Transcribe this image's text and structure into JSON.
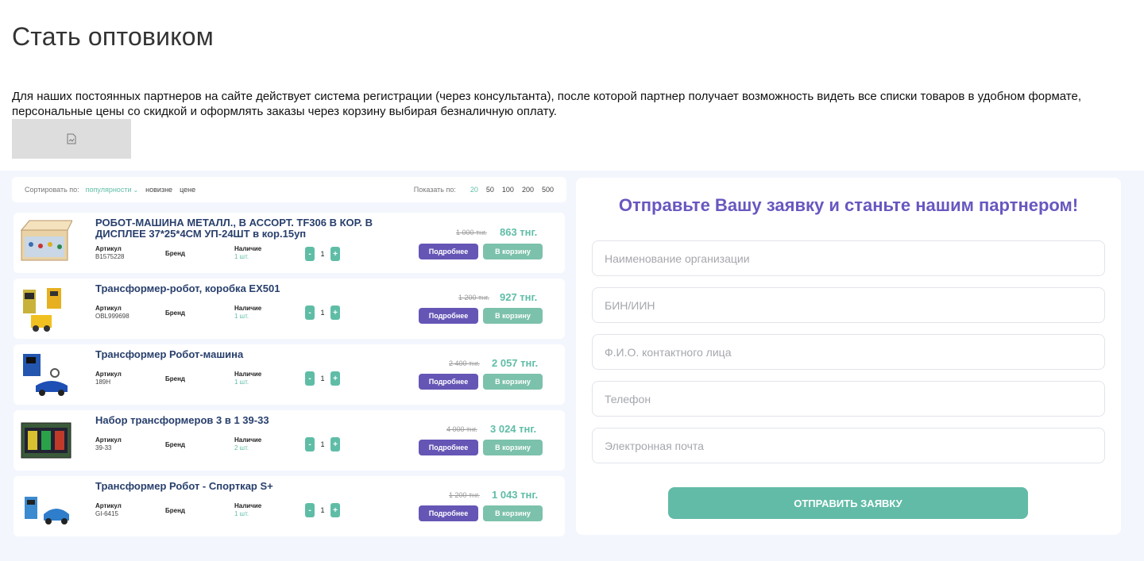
{
  "page": {
    "title": "Стать оптовиком",
    "intro": "Для наших постоянных партнеров на сайте действует система регистрации (через консультанта), после которой партнер получает возможность видеть все списки товаров в удобном формате, персональные цены со скидкой и оформлять заказы через корзину выбирая безналичную оплату."
  },
  "preview": {
    "sort_label": "Сортировать по:",
    "sort_options": [
      "популярности",
      "новизне",
      "цене"
    ],
    "show_label": "Показать по:",
    "show_options": [
      "20",
      "50",
      "100",
      "200",
      "500"
    ],
    "col_article": "Артикул",
    "col_brand": "Бренд",
    "col_stock": "Наличие",
    "more_label": "Подробнее",
    "cart_label": "В корзину",
    "products": [
      {
        "name": "РОБОТ-МАШИНА МЕТАЛЛ., В АССОРТ. TF306 В КОР. В ДИСПЛЕЕ 37*25*4СМ УП-24ШТ в кор.15уп",
        "article": "B1575228",
        "stock": "1 шт.",
        "qty": "1",
        "old_price": "1 000 тнг.",
        "price": "863 тнг."
      },
      {
        "name": "Трансформер-робот, коробка EX501",
        "article": "OBL999698",
        "stock": "1 шт.",
        "qty": "1",
        "old_price": "1 200 тнг.",
        "price": "927 тнг."
      },
      {
        "name": "Трансформер Робот-машина",
        "article": "189H",
        "stock": "1 шт.",
        "qty": "1",
        "old_price": "2 400 тнг.",
        "price": "2 057 тнг."
      },
      {
        "name": "Набор трансформеров 3 в 1 39-33",
        "article": "39-33",
        "stock": "2 шт.",
        "qty": "1",
        "old_price": "4 000 тнг.",
        "price": "3 024 тнг."
      },
      {
        "name": "Трансформер Робот - Спорткар S+",
        "article": "GI-6415",
        "stock": "1 шт.",
        "qty": "1",
        "old_price": "1 200 тнг.",
        "price": "1 043 тнг."
      }
    ]
  },
  "form": {
    "title": "Отправьте Вашу заявку и станьте нашим партнером!",
    "fields": [
      {
        "placeholder": "Наименование организации"
      },
      {
        "placeholder": "БИН/ИИН"
      },
      {
        "placeholder": "Ф.И.О. контактного лица"
      },
      {
        "placeholder": "Телефон"
      },
      {
        "placeholder": "Электронная почта"
      }
    ],
    "submit_label": "ОТПРАВИТЬ ЗАЯВКУ"
  },
  "colors": {
    "accent_green": "#5fbda6",
    "accent_purple": "#6957c0",
    "title_navy": "#283f6c"
  }
}
